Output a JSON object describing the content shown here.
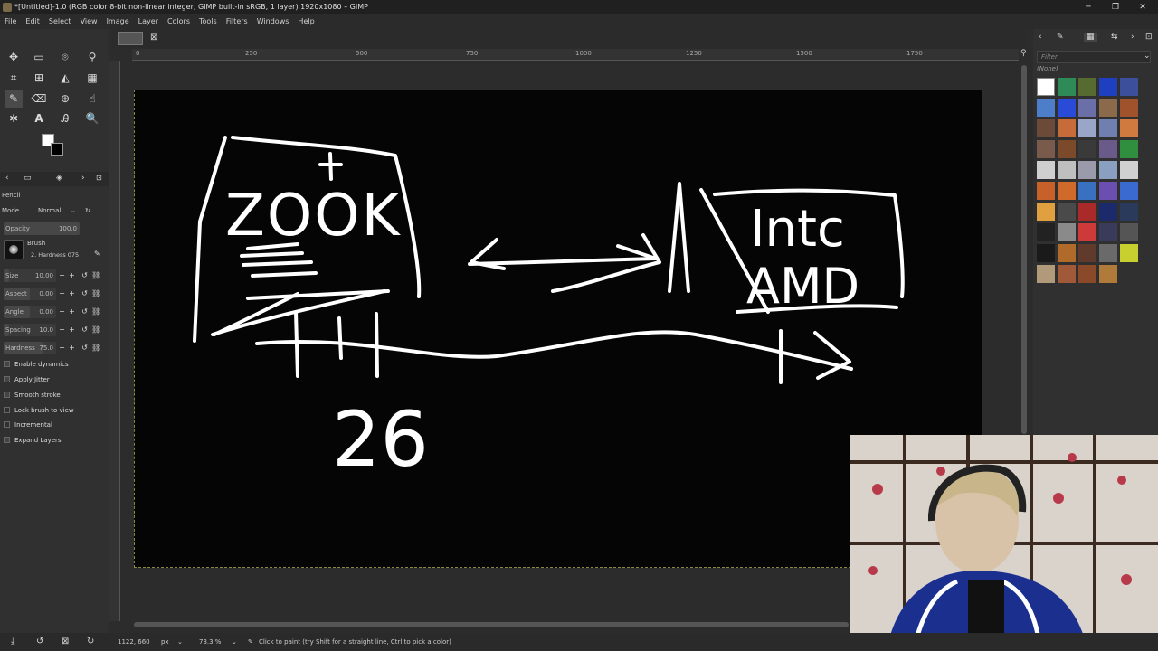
{
  "window": {
    "title": "*[Untitled]-1.0 (RGB color 8-bit non-linear integer, GIMP built-in sRGB, 1 layer) 1920x1080 – GIMP",
    "minimize": "─",
    "maximize": "❐",
    "close": "✕"
  },
  "menu": [
    "File",
    "Edit",
    "Select",
    "View",
    "Image",
    "Layer",
    "Colors",
    "Tools",
    "Filters",
    "Windows",
    "Help"
  ],
  "tool_options": {
    "tool_name": "Pencil",
    "mode_label": "Mode",
    "mode_value": "Normal",
    "opacity_label": "Opacity",
    "opacity_value": "100.0",
    "brush_label": "Brush",
    "brush_value": "2. Hardness 075",
    "size_label": "Size",
    "size_value": "10.00",
    "aspect_label": "Aspect",
    "aspect_value": "0.00",
    "angle_label": "Angle",
    "angle_value": "0.00",
    "spacing_label": "Spacing",
    "spacing_value": "10.0",
    "hardness_label": "Hardness",
    "hardness_value": "75.0",
    "checks": [
      {
        "label": "Enable dynamics",
        "checked": true
      },
      {
        "label": "Apply Jitter",
        "checked": true
      },
      {
        "label": "Smooth stroke",
        "checked": true
      },
      {
        "label": "Lock brush to view",
        "checked": false
      },
      {
        "label": "Incremental",
        "checked": false
      },
      {
        "label": "Expand Layers",
        "checked": true
      }
    ]
  },
  "ruler": {
    "h_labels": [
      "0",
      "250",
      "500",
      "750",
      "1000",
      "1250",
      "1500",
      "1750"
    ]
  },
  "patterns_panel": {
    "filter_placeholder": "Filter",
    "tag_value": "(None)"
  },
  "status": {
    "coords": "1122, 660",
    "unit": "px",
    "zoom": "73.3 %",
    "message": "Click to paint (try Shift for a straight line, Ctrl to pick a color)"
  },
  "colors": {
    "canvas_bg": "#050505",
    "stroke": "#ffffff",
    "ui_bg": "#303030",
    "webcam_jacket": "#1b2f8f"
  },
  "drawing_text": {
    "box1": "ZOOK",
    "box2_line1": "Intc",
    "box2_line2": "AMD",
    "number": "26"
  }
}
